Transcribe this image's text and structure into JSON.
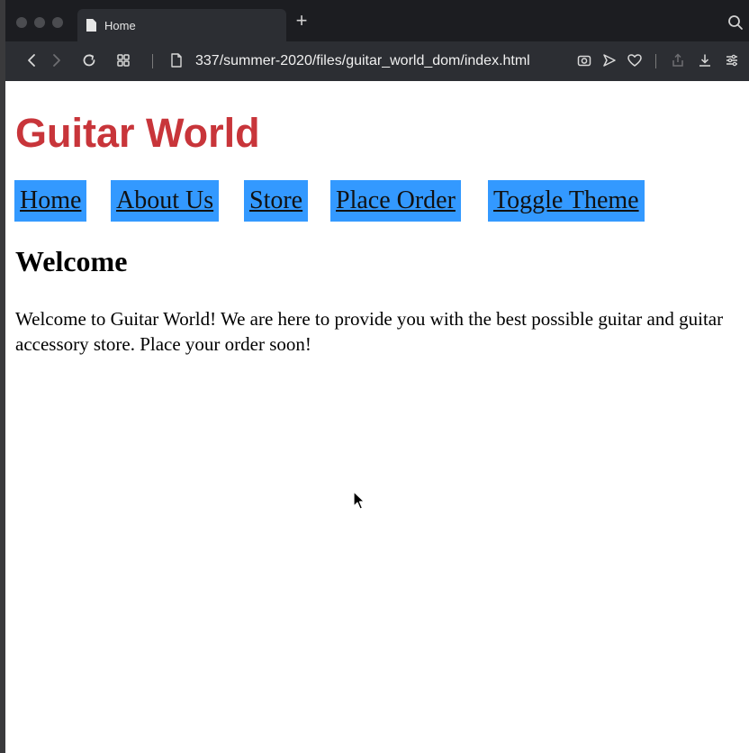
{
  "browser": {
    "tab_title": "Home",
    "new_tab_label": "+",
    "url": "337/summer-2020/files/guitar_world_dom/index.html",
    "icons": [
      "back-icon",
      "forward-icon",
      "reload-icon",
      "tabs-grid-icon",
      "page-icon",
      "camera-icon",
      "send-icon",
      "heart-icon",
      "share-icon",
      "download-icon",
      "menu-icon",
      "search-icon"
    ]
  },
  "page": {
    "site_title": "Guitar World",
    "nav": [
      {
        "label": "Home"
      },
      {
        "label": "About Us"
      },
      {
        "label": "Store"
      },
      {
        "label": "Place Order"
      },
      {
        "label": "Toggle Theme"
      }
    ],
    "heading": "Welcome",
    "body_text": "Welcome to Guitar World! We are here to provide you with the best possible guitar and guitar accessory store. Place your order soon!"
  },
  "colors": {
    "title": "#c8353a",
    "nav_bg": "#3399ff",
    "chrome_dark": "#1c1d21",
    "toolbar": "#2c2e33"
  }
}
